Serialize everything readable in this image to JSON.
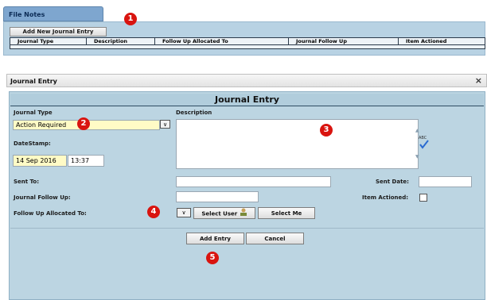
{
  "file_notes": {
    "tab_label": "File Notes",
    "add_button": "Add New Journal Entry",
    "columns": [
      "Journal Type",
      "Description",
      "Follow Up Allocated To",
      "Journal Follow Up",
      "Item Actioned"
    ]
  },
  "markers": [
    "1",
    "2",
    "3",
    "4",
    "5"
  ],
  "dialog": {
    "title": "Journal Entry",
    "close_icon": "×",
    "header": "Journal Entry",
    "journal_type_label": "Journal Type",
    "journal_type_value": "Action Required",
    "description_label": "Description",
    "datestamp_label": "DateStamp:",
    "date_value": "14 Sep 2016",
    "time_value": "13:37",
    "sent_to_label": "Sent To:",
    "sent_date_label": "Sent Date:",
    "journal_follow_up_label": "Journal Follow Up:",
    "item_actioned_label": "Item Actioned:",
    "follow_up_allocated_label": "Follow Up Allocated To:",
    "select_user_label": "Select User",
    "select_me_label": "Select Me",
    "add_entry_label": "Add Entry",
    "cancel_label": "Cancel",
    "spellcheck_text": "ABC"
  },
  "colors": {
    "panel_blue": "#b8d2e3",
    "tab_blue": "#7ea6cf",
    "marker_red": "#d9140f",
    "date_yellow": "#fffbc6"
  }
}
